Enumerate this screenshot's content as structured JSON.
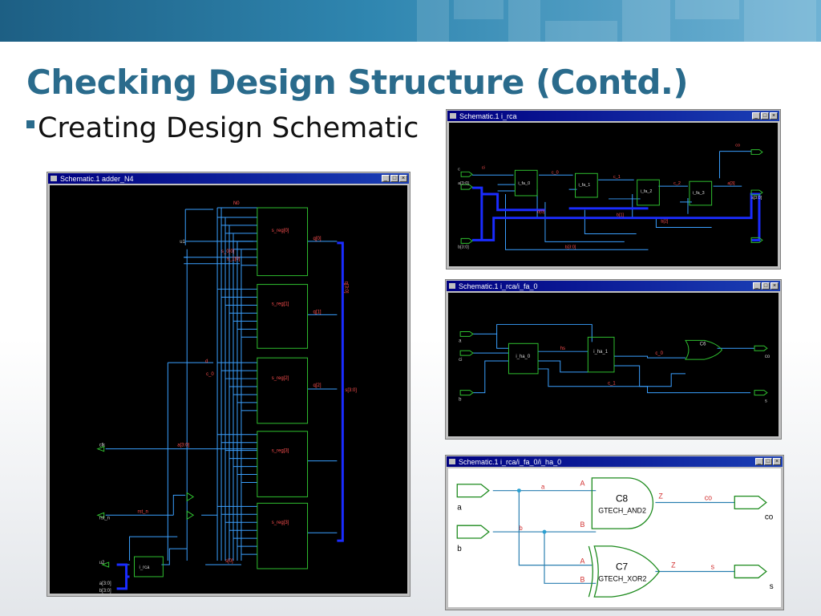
{
  "slide": {
    "title": "Checking Design Structure (Contd.)",
    "bullet": "Creating Design Schematic"
  },
  "colors": {
    "banner": "#2a7fae",
    "title": "#2a6b8c",
    "wire": "#3aa0ff",
    "box": "#2fbf2f"
  },
  "windows": {
    "top_right": {
      "title": "Schematic.1   i_rca",
      "labels": {
        "c": "c",
        "ci": "ci",
        "a": "a[3:0]",
        "b": "b[3:0]",
        "s": "s[3:0]",
        "co": "co",
        "fa0": "i_fa_0",
        "fa1": "i_fa_1",
        "fa2": "i_fa_2",
        "fa3": "i_fa_3",
        "c0": "c_0",
        "c1": "c_1",
        "c2": "c_2",
        "b0": "b[0]",
        "b1": "b[1]",
        "b2": "b[2]",
        "a3": "a[3]",
        "bs": "b[3:0]"
      }
    },
    "mid_right": {
      "title": "Schematic.1   i_rca/i_fa_0",
      "labels": {
        "a": "a",
        "b": "b",
        "ci": "ci",
        "co": "co",
        "s": "s",
        "ha0": "i_ha_0",
        "ha1": "i_ha_1",
        "hs": "hs",
        "c0": "c_0",
        "c1": "c_1",
        "gate": "C6"
      }
    },
    "bottom_right": {
      "title": "Schematic.1   i_rca/i_fa_0/i_ha_0",
      "labels": {
        "a": "a",
        "b": "b",
        "A1": "A",
        "B1": "B",
        "Z1": "Z",
        "A2": "A",
        "B2": "B",
        "Z2": "Z",
        "c8": "C8",
        "and2": "GTECH_AND2",
        "c7": "C7",
        "xor2": "GTECH_XOR2",
        "co_net": "co",
        "co_port": "co",
        "s_net": "s",
        "s_port": "s",
        "a_net": "a",
        "b_net": "b"
      }
    },
    "left": {
      "title": "Schematic.1   adder_N4",
      "labels": {
        "n1": "N0",
        "u1": "u1",
        "s0": "s_0[0]",
        "s1": "s_1[0]",
        "sreg0": "s_reg[0]",
        "sreg1": "s_reg[1]",
        "sreg2": "s_reg[2]",
        "sreg3": "s_reg[3]",
        "sreg4": "s_reg[3]",
        "q0": "q[0]",
        "q1": "q[1]",
        "q2": "q[2]",
        "q3": "q[3:0]",
        "sbus": "s[3:0]",
        "ab": "a[3:0]",
        "clk": "clk",
        "rst": "rst_n",
        "rstn": "rst_n",
        "ir": "i_rca",
        "u2": "u2",
        "a": "a[3:0]",
        "b": "b[3:0]",
        "d": "d",
        "ck": "c_0",
        "n2": "s[0]"
      }
    }
  }
}
